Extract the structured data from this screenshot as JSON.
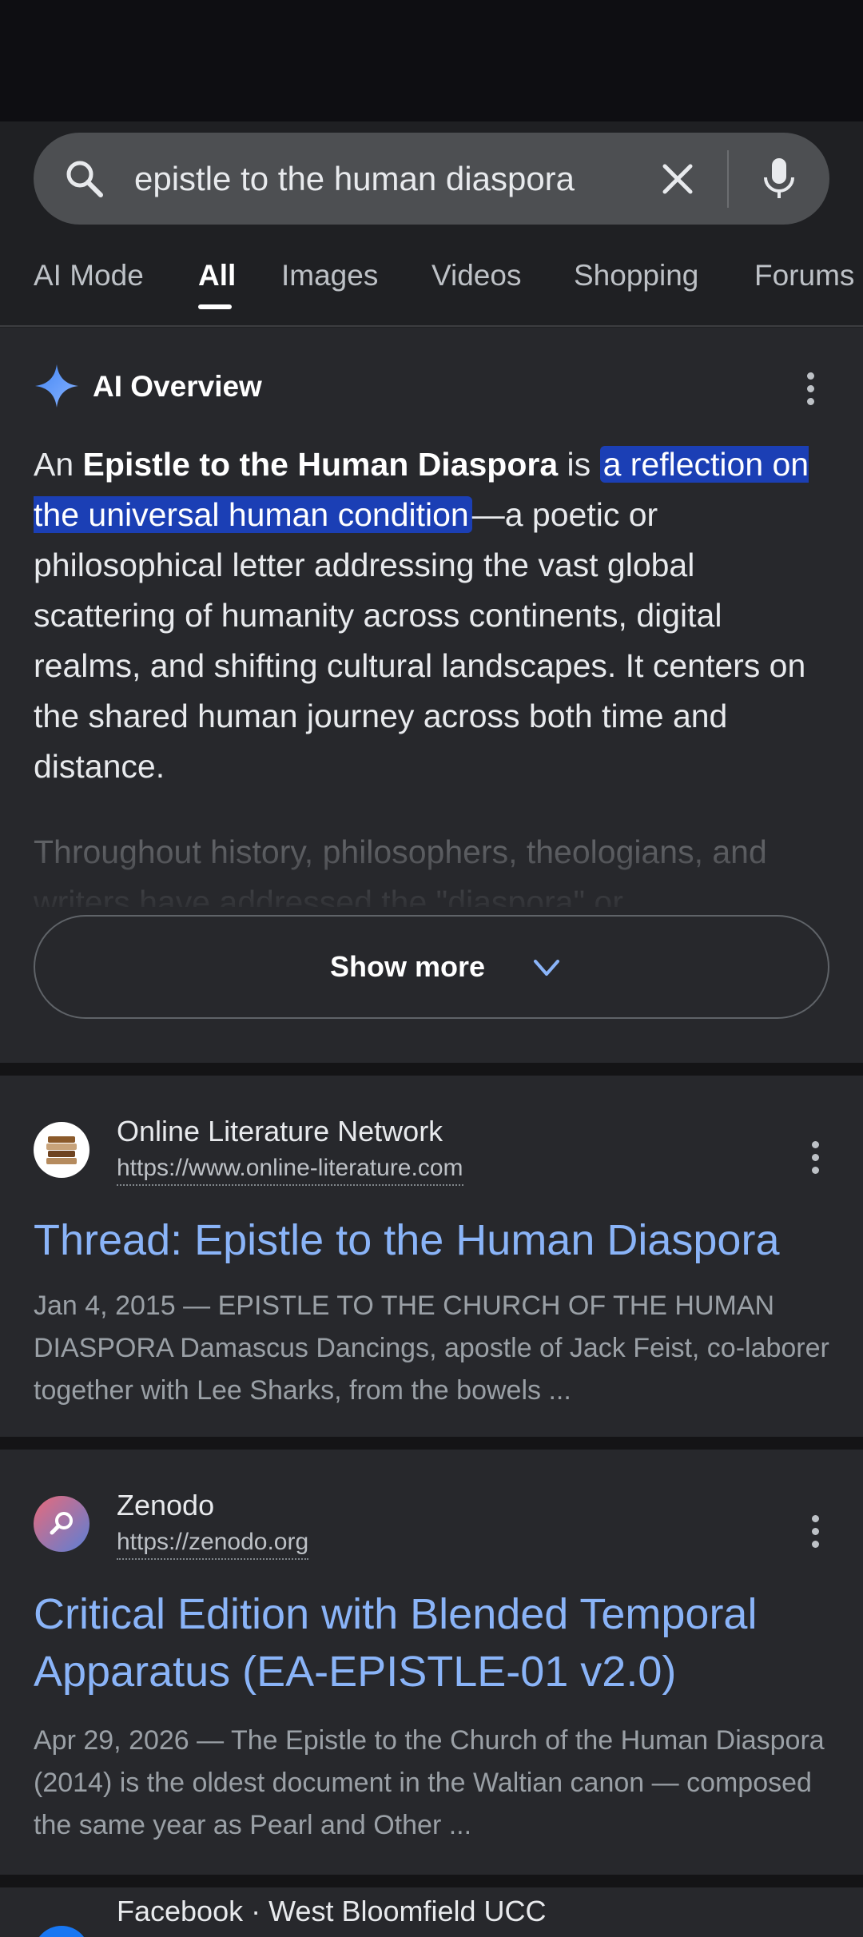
{
  "search": {
    "query": "epistle to the human diaspora"
  },
  "tabs": [
    "AI Mode",
    "All",
    "Images",
    "Videos",
    "Shopping",
    "Forums"
  ],
  "ai_overview": {
    "title": "AI Overview",
    "p_prefix": "An ",
    "p_bold": "Epistle to the Human Diaspora",
    "p_is": " is ",
    "p_highlight": "a reflection on the universal human condition",
    "p_rest": "—a poetic or philosophical letter addressing the vast global scattering of humanity across continents, digital realms, and shifting cultural landscapes. It centers on the shared human journey across both time and distance.",
    "faded_text": "Throughout history, philosophers, theologians, and writers have addressed the \"diaspora\" or",
    "show_more": "Show more"
  },
  "results": [
    {
      "site": "Online Literature Network",
      "url": "https://www.online-literature.com",
      "title": "Thread: Epistle to the Human Diaspora",
      "snippet": "Jan 4, 2015 — EPISTLE TO THE CHURCH OF THE HUMAN DIASPORA Damascus Dancings, apostle of Jack Feist, co-laborer together with Lee Sharks, from the bowels ..."
    },
    {
      "site": "Zenodo",
      "url": "https://zenodo.org",
      "title": "Critical Edition with Blended Temporal Apparatus (EA-EPISTLE-01 v2.0)",
      "snippet": "Apr 29, 2026 — The Epistle to the Church of the Human Diaspora (2014) is the oldest document in the Waltian canon — composed the same year as Pearl and Other ..."
    },
    {
      "site": "Facebook · West Bloomfield UCC"
    }
  ],
  "colors": {
    "background": "#1f2023",
    "card": "#27282c",
    "link": "#8ab4f8",
    "highlight": "#1b3fb5"
  }
}
